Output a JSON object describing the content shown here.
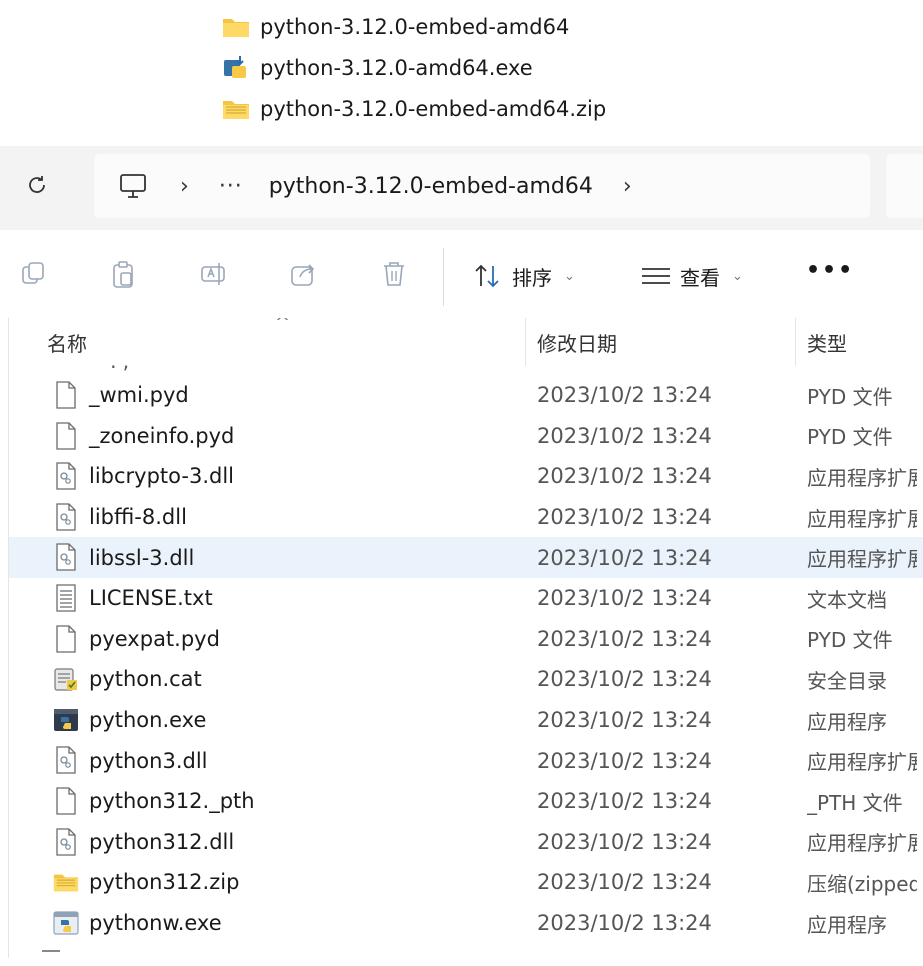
{
  "top_files": [
    {
      "name": "python-3.12.0-embed-amd64",
      "icon": "folder-icon"
    },
    {
      "name": "python-3.12.0-amd64.exe",
      "icon": "installer-icon"
    },
    {
      "name": "python-3.12.0-embed-amd64.zip",
      "icon": "zip-folder-icon"
    }
  ],
  "address_bar": {
    "overflow": "···",
    "crumb": "python-3.12.0-embed-amd64",
    "chevron": "›"
  },
  "toolbar": {
    "sort_label": "排序",
    "view_label": "查看",
    "more_label": "•••"
  },
  "table": {
    "headers": {
      "name": "名称",
      "modified": "修改日期",
      "type": "类型"
    },
    "rows": [
      {
        "name": "_wmi.pyd",
        "date": "2023/10/2 13:24",
        "type": "PYD 文件",
        "icon": "file-icon"
      },
      {
        "name": "_zoneinfo.pyd",
        "date": "2023/10/2 13:24",
        "type": "PYD 文件",
        "icon": "file-icon"
      },
      {
        "name": "libcrypto-3.dll",
        "date": "2023/10/2 13:24",
        "type": "应用程序扩展",
        "icon": "dll-icon"
      },
      {
        "name": "libffi-8.dll",
        "date": "2023/10/2 13:24",
        "type": "应用程序扩展",
        "icon": "dll-icon"
      },
      {
        "name": "libssl-3.dll",
        "date": "2023/10/2 13:24",
        "type": "应用程序扩展",
        "icon": "dll-icon",
        "selected": true
      },
      {
        "name": "LICENSE.txt",
        "date": "2023/10/2 13:24",
        "type": "文本文档",
        "icon": "text-file-icon"
      },
      {
        "name": "pyexpat.pyd",
        "date": "2023/10/2 13:24",
        "type": "PYD 文件",
        "icon": "file-icon"
      },
      {
        "name": "python.cat",
        "date": "2023/10/2 13:24",
        "type": "安全目录",
        "icon": "catalog-icon"
      },
      {
        "name": "python.exe",
        "date": "2023/10/2 13:24",
        "type": "应用程序",
        "icon": "python-exe-icon"
      },
      {
        "name": "python3.dll",
        "date": "2023/10/2 13:24",
        "type": "应用程序扩展",
        "icon": "dll-icon"
      },
      {
        "name": "python312._pth",
        "date": "2023/10/2 13:24",
        "type": "_PTH 文件",
        "icon": "file-icon"
      },
      {
        "name": "python312.dll",
        "date": "2023/10/2 13:24",
        "type": "应用程序扩展",
        "icon": "dll-icon"
      },
      {
        "name": "python312.zip",
        "date": "2023/10/2 13:24",
        "type": "压缩(zipped)",
        "icon": "zip-folder-icon"
      },
      {
        "name": "pythonw.exe",
        "date": "2023/10/2 13:24",
        "type": "应用程序",
        "icon": "pythonw-exe-icon"
      }
    ]
  },
  "colors": {
    "selected_row": "#eaf3fb",
    "folder": "#f5c542",
    "python_blue": "#3572a5",
    "python_yellow": "#f7c948"
  }
}
